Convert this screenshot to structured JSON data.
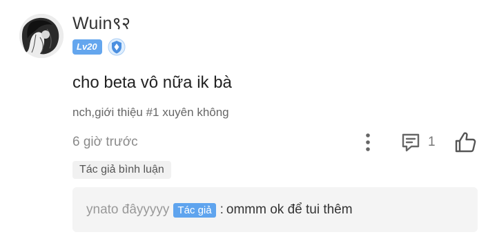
{
  "comment": {
    "username": "Wuin९२",
    "level": "Lv20",
    "content": "cho beta vô nữa ik bà",
    "tags": "nch,giới thiệu #1 xuyên không",
    "time": "6 giờ trước",
    "comment_count": "1",
    "author_comment_label": "Tác giả bình luận"
  },
  "reply": {
    "user": "ynato đâyyyyy",
    "author_badge": "Tác giả",
    "separator": ":",
    "text": "ommm ok để tui thêm"
  },
  "icons": {
    "avatar": "avatar-image",
    "badge": "shield-badge-icon",
    "more": "more-vertical-icon",
    "comment": "comment-icon",
    "like": "thumbs-up-icon"
  },
  "colors": {
    "level_badge": "#64a6ee",
    "author_badge": "#5fa4ee",
    "reply_bg": "#f4f4f4"
  }
}
